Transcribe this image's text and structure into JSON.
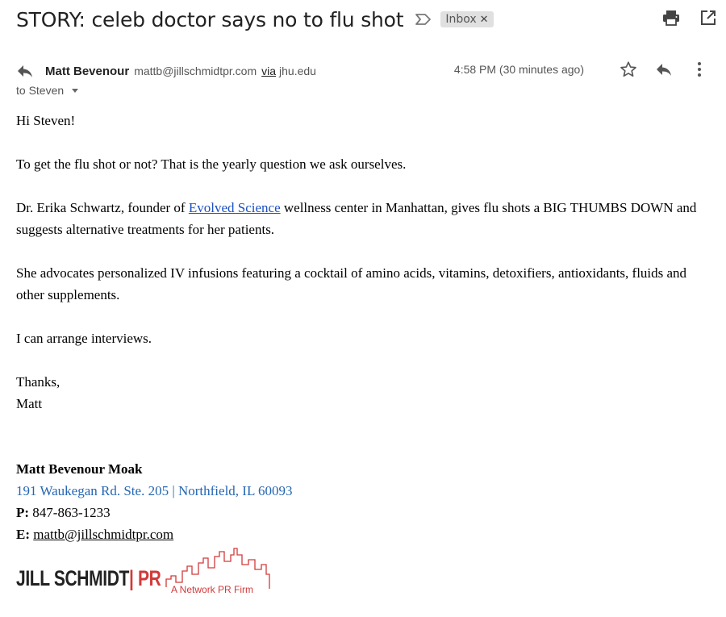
{
  "subject": "STORY: celeb doctor says no to flu shot",
  "label": "Inbox",
  "sender": {
    "name": "Matt Bevenour",
    "email": "mattb@jillschmidtpr.com",
    "via": "via",
    "via_domain": "jhu.edu",
    "timestamp": "4:58 PM (30 minutes ago)",
    "to": "to Steven"
  },
  "body": {
    "greeting": "Hi Steven!",
    "p1": "To get the flu shot or not? That is the yearly question we ask ourselves.",
    "p2_before": "Dr. Erika Schwartz, founder of ",
    "p2_link": "Evolved Science",
    "p2_after": " wellness center in Manhattan, gives flu shots a BIG THUMBS DOWN and suggests alternative treatments for her patients.",
    "p3": "She advocates personalized IV infusions featuring a cocktail of amino acids, vitamins, detoxifiers, antioxidants, fluids and other supplements.",
    "p4": "I can arrange interviews.",
    "closing": "Thanks,",
    "closing_name": "Matt"
  },
  "signature": {
    "name": "Matt Bevenour Moak",
    "address": "191 Waukegan Rd. Ste. 205 | Northfield, IL 60093",
    "phone_label": "P:",
    "phone": " 847-863-1233",
    "email_label": "E:",
    "email": "mattb@jillschmidtpr.com",
    "logo_main": "JILL SCHMIDT",
    "logo_sep": "|",
    "logo_pr": " PR",
    "logo_tagline": "A Network PR Firm"
  },
  "icons": {
    "importance": "importance-marker-icon",
    "print": "print-icon",
    "popout": "open-in-new-window-icon",
    "reply_small": "reply-icon",
    "star": "star-icon",
    "reply": "reply-icon",
    "more": "more-vertical-icon"
  },
  "colors": {
    "link": "#1a4fc4",
    "address": "#2466b3",
    "brand_red": "#d23a3a"
  }
}
